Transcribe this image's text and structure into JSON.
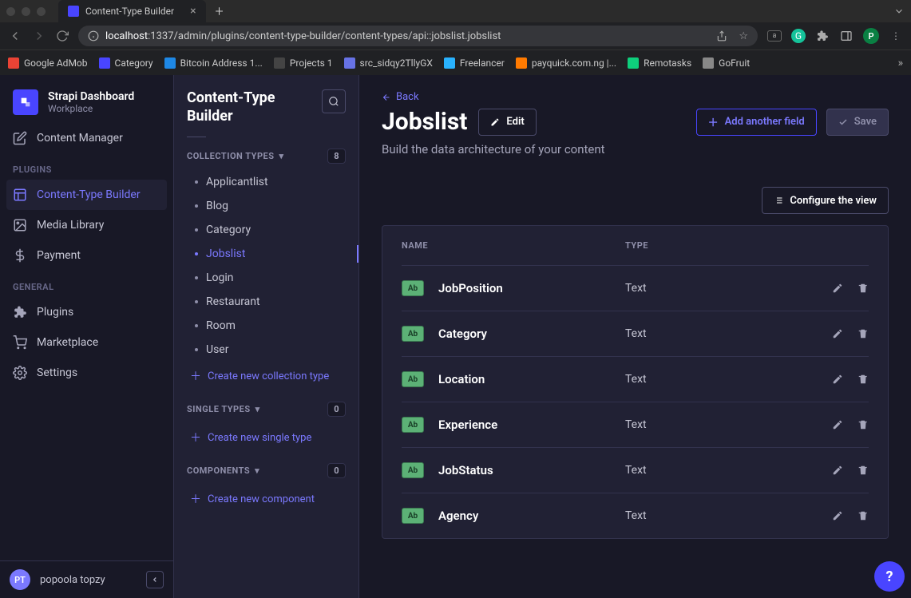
{
  "browser": {
    "tab_title": "Content-Type Builder",
    "url_host": "localhost",
    "url_port_path": ":1337/admin/plugins/content-type-builder/content-types/api::jobslist.jobslist",
    "bookmarks": [
      {
        "label": "Google AdMob",
        "color": "#ea4335"
      },
      {
        "label": "Category",
        "color": "#4945ff"
      },
      {
        "label": "Bitcoin Address 1...",
        "color": "#1e88e5"
      },
      {
        "label": "Projects 1",
        "color": "#444"
      },
      {
        "label": "src_sidqy2TllyGX",
        "color": "#6772e5"
      },
      {
        "label": "Freelancer",
        "color": "#29b2fe"
      },
      {
        "label": "payquick.com.ng |...",
        "color": "#ff7a00"
      },
      {
        "label": "Remotasks",
        "color": "#0ecf7c"
      },
      {
        "label": "GoFruit",
        "color": "#888"
      }
    ]
  },
  "brand": {
    "title": "Strapi Dashboard",
    "subtitle": "Workplace"
  },
  "nav": {
    "top": [
      {
        "label": "Content Manager",
        "icon": "pencil"
      }
    ],
    "plugins_label": "PLUGINS",
    "plugins": [
      {
        "label": "Content-Type Builder",
        "icon": "layout",
        "active": true
      },
      {
        "label": "Media Library",
        "icon": "image"
      },
      {
        "label": "Payment",
        "icon": "dollar"
      }
    ],
    "general_label": "GENERAL",
    "general": [
      {
        "label": "Plugins",
        "icon": "puzzle"
      },
      {
        "label": "Marketplace",
        "icon": "cart"
      },
      {
        "label": "Settings",
        "icon": "gear"
      }
    ]
  },
  "user": {
    "initials": "PT",
    "name": "popoola topzy"
  },
  "panel": {
    "title": "Content-Type Builder",
    "groups": {
      "collection": {
        "label": "COLLECTION TYPES",
        "count": "8",
        "items": [
          "Applicantlist",
          "Blog",
          "Category",
          "Jobslist",
          "Login",
          "Restaurant",
          "Room",
          "User"
        ],
        "active_index": 3,
        "create": "Create new collection type"
      },
      "single": {
        "label": "SINGLE TYPES",
        "count": "0",
        "create": "Create new single type"
      },
      "components": {
        "label": "COMPONENTS",
        "count": "0",
        "create": "Create new component"
      }
    }
  },
  "main": {
    "back": "Back",
    "title": "Jobslist",
    "edit": "Edit",
    "add_field": "Add another field",
    "save": "Save",
    "subtitle": "Build the data architecture of your content",
    "configure": "Configure the view",
    "columns": {
      "name": "NAME",
      "type": "TYPE"
    },
    "field_badge": "Ab",
    "fields": [
      {
        "name": "JobPosition",
        "type": "Text"
      },
      {
        "name": "Category",
        "type": "Text"
      },
      {
        "name": "Location",
        "type": "Text"
      },
      {
        "name": "Experience",
        "type": "Text"
      },
      {
        "name": "JobStatus",
        "type": "Text"
      },
      {
        "name": "Agency",
        "type": "Text"
      }
    ]
  }
}
